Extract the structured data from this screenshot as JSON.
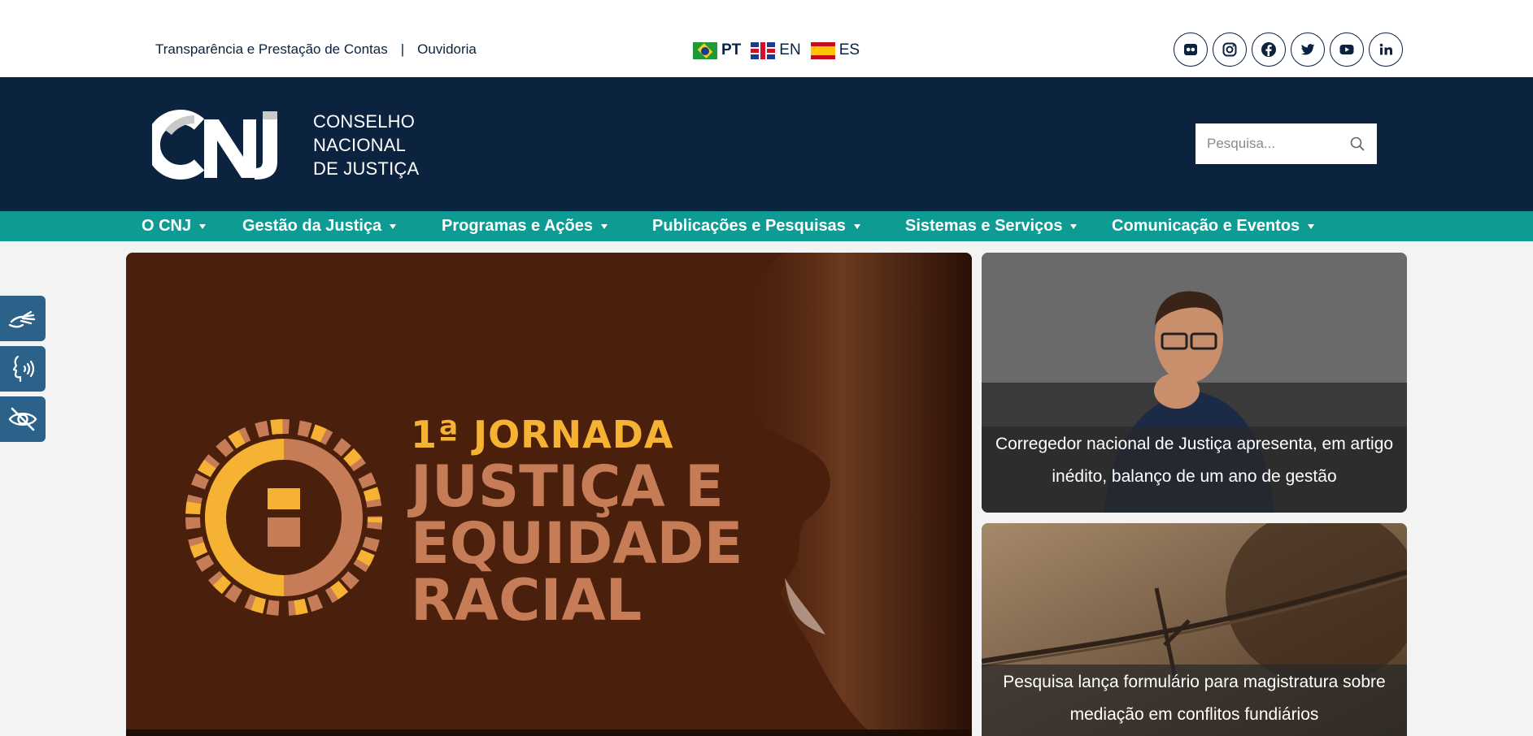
{
  "utility": {
    "transparency": "Transparência e Prestação de Contas",
    "separator": "|",
    "ombudsman": "Ouvidoria"
  },
  "languages": [
    {
      "code": "PT",
      "flag": "brazil-flag-icon",
      "active": true
    },
    {
      "code": "EN",
      "flag": "uk-flag-icon",
      "active": false
    },
    {
      "code": "ES",
      "flag": "spain-flag-icon",
      "active": false
    }
  ],
  "socials": [
    "flickr-icon",
    "instagram-icon",
    "facebook-icon",
    "twitter-icon",
    "youtube-icon",
    "linkedin-icon"
  ],
  "logo": {
    "line1": "CONSELHO",
    "line2": "NACIONAL",
    "line3": "DE JUSTIÇA"
  },
  "search": {
    "placeholder": "Pesquisa..."
  },
  "nav": {
    "items": [
      {
        "label": "O CNJ"
      },
      {
        "label": "Gestão da Justiça"
      },
      {
        "label": "Programas e Ações"
      },
      {
        "label": "Publicações e Pesquisas"
      },
      {
        "label": "Sistemas e Serviços"
      },
      {
        "label": "Comunicação e Eventos"
      }
    ]
  },
  "accessibility": [
    "sign-language-icon",
    "voice-reader-icon",
    "low-vision-icon"
  ],
  "hero": {
    "kicker": "1ª JORNADA",
    "title_line1": "JUSTIÇA E",
    "title_line2": "EQUIDADE",
    "title_line3": "RACIAL"
  },
  "cards": [
    {
      "caption": "Corregedor nacional de Justiça apresenta, em artigo inédito, balanço de um ano de gestão"
    },
    {
      "caption": "Pesquisa lança formulário para magistratura sobre mediação em conflitos fundiários"
    }
  ],
  "colors": {
    "navy": "#0c2340",
    "teal": "#0e9b93",
    "hero_bg": "#4a1f0c",
    "hero_gold": "#f6b333",
    "hero_copper": "#c67d57",
    "a11y_blue": "#2c6189"
  }
}
